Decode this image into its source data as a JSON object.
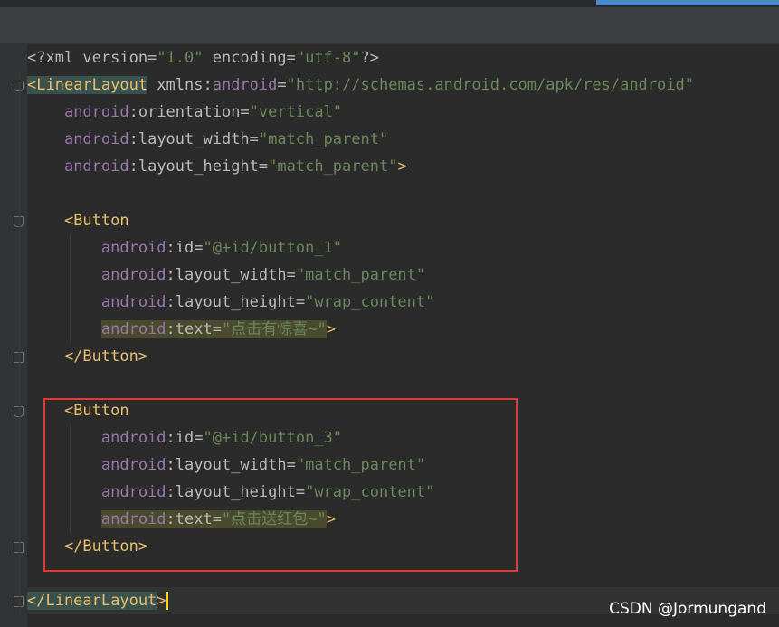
{
  "editor": {
    "lines": [
      {
        "segments": [
          {
            "t": "<?xml version=",
            "c": "attr"
          },
          {
            "t": "\"1.0\"",
            "c": "val"
          },
          {
            "t": " encoding=",
            "c": "attr"
          },
          {
            "t": "\"utf-8\"",
            "c": "val"
          },
          {
            "t": "?>",
            "c": "attr"
          }
        ]
      },
      {
        "segments": [
          {
            "t": "<LinearLayout",
            "c": "tag bracket-match"
          },
          {
            "t": " xmlns:",
            "c": "attr"
          },
          {
            "t": "android",
            "c": "ns"
          },
          {
            "t": "=",
            "c": "attr"
          },
          {
            "t": "\"http://schemas.android.com/apk/res/android\"",
            "c": "val"
          }
        ]
      },
      {
        "segments": [
          {
            "t": "    ",
            "c": ""
          },
          {
            "t": "android",
            "c": "ns"
          },
          {
            "t": ":orientation=",
            "c": "attr"
          },
          {
            "t": "\"vertical\"",
            "c": "val"
          }
        ]
      },
      {
        "segments": [
          {
            "t": "    ",
            "c": ""
          },
          {
            "t": "android",
            "c": "ns"
          },
          {
            "t": ":layout_width=",
            "c": "attr"
          },
          {
            "t": "\"match_parent\"",
            "c": "val"
          }
        ]
      },
      {
        "segments": [
          {
            "t": "    ",
            "c": ""
          },
          {
            "t": "android",
            "c": "ns"
          },
          {
            "t": ":layout_height=",
            "c": "attr"
          },
          {
            "t": "\"match_parent\"",
            "c": "val"
          },
          {
            "t": ">",
            "c": "tag"
          }
        ]
      },
      {
        "segments": [
          {
            "t": "",
            "c": ""
          }
        ]
      },
      {
        "segments": [
          {
            "t": "    ",
            "c": ""
          },
          {
            "t": "<Button",
            "c": "tag"
          }
        ]
      },
      {
        "segments": [
          {
            "t": "        ",
            "c": ""
          },
          {
            "t": "android",
            "c": "ns"
          },
          {
            "t": ":id=",
            "c": "attr"
          },
          {
            "t": "\"@+id/button_1\"",
            "c": "val"
          }
        ]
      },
      {
        "segments": [
          {
            "t": "        ",
            "c": ""
          },
          {
            "t": "android",
            "c": "ns"
          },
          {
            "t": ":layout_width=",
            "c": "attr"
          },
          {
            "t": "\"match_parent\"",
            "c": "val"
          }
        ]
      },
      {
        "segments": [
          {
            "t": "        ",
            "c": ""
          },
          {
            "t": "android",
            "c": "ns"
          },
          {
            "t": ":layout_height=",
            "c": "attr"
          },
          {
            "t": "\"wrap_content\"",
            "c": "val"
          }
        ]
      },
      {
        "segments": [
          {
            "t": "        ",
            "c": ""
          },
          {
            "t": "android",
            "c": "ns hl-attr"
          },
          {
            "t": ":text=",
            "c": "attr hl-attr"
          },
          {
            "t": "\"点击有惊喜~\"",
            "c": "val hl-attr"
          },
          {
            "t": ">",
            "c": "tag"
          }
        ]
      },
      {
        "segments": [
          {
            "t": "    ",
            "c": ""
          },
          {
            "t": "</Button>",
            "c": "tag"
          }
        ]
      },
      {
        "segments": [
          {
            "t": "",
            "c": ""
          }
        ]
      },
      {
        "segments": [
          {
            "t": "    ",
            "c": ""
          },
          {
            "t": "<Button",
            "c": "tag"
          }
        ]
      },
      {
        "segments": [
          {
            "t": "        ",
            "c": ""
          },
          {
            "t": "android",
            "c": "ns"
          },
          {
            "t": ":id=",
            "c": "attr"
          },
          {
            "t": "\"@+id/button_3\"",
            "c": "val"
          }
        ]
      },
      {
        "segments": [
          {
            "t": "        ",
            "c": ""
          },
          {
            "t": "android",
            "c": "ns"
          },
          {
            "t": ":layout_width=",
            "c": "attr"
          },
          {
            "t": "\"match_parent\"",
            "c": "val"
          }
        ]
      },
      {
        "segments": [
          {
            "t": "        ",
            "c": ""
          },
          {
            "t": "android",
            "c": "ns"
          },
          {
            "t": ":layout_height=",
            "c": "attr"
          },
          {
            "t": "\"wrap_content\"",
            "c": "val"
          }
        ]
      },
      {
        "segments": [
          {
            "t": "        ",
            "c": ""
          },
          {
            "t": "android",
            "c": "ns hl-attr"
          },
          {
            "t": ":text=",
            "c": "attr hl-attr"
          },
          {
            "t": "\"点击送红包~\"",
            "c": "val hl-attr"
          },
          {
            "t": ">",
            "c": "tag"
          }
        ]
      },
      {
        "segments": [
          {
            "t": "    ",
            "c": ""
          },
          {
            "t": "</Button>",
            "c": "tag"
          }
        ]
      },
      {
        "segments": [
          {
            "t": "",
            "c": ""
          }
        ]
      },
      {
        "segments": [
          {
            "t": "</LinearLayout",
            "c": "tag bracket-match"
          },
          {
            "t": ">",
            "c": "tag"
          }
        ],
        "caret": true,
        "current": true
      }
    ]
  },
  "colors": {
    "background": "#2b2b2b",
    "tag": "#e8bf6a",
    "namespace": "#9876aa",
    "value": "#6a8759",
    "selection_border": "#e0393a"
  },
  "watermark": "CSDN @Jormungand"
}
